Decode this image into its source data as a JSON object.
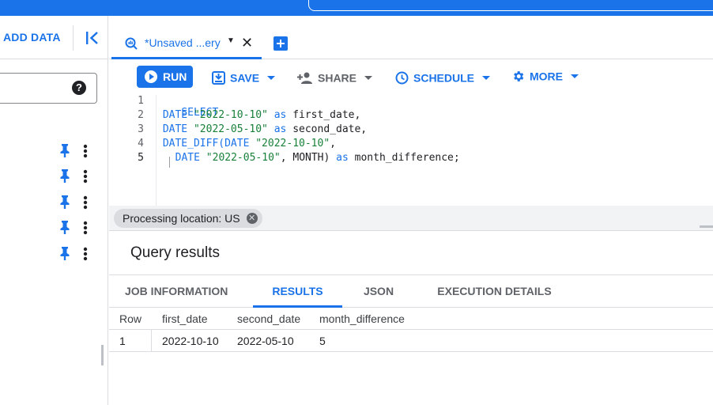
{
  "topbar": {
    "search_text": "",
    "crop_text": ""
  },
  "sidebar": {
    "add_data_label": "ADD DATA",
    "help_glyph": "?",
    "pin_rows": 5
  },
  "tab": {
    "label": "*Unsaved ...ery",
    "close_glyph": "✕"
  },
  "toolbar": {
    "run_label": "RUN",
    "save_label": "SAVE",
    "share_label": "SHARE",
    "schedule_label": "SCHEDULE",
    "more_label": "MORE"
  },
  "editor": {
    "line_numbers": [
      "1",
      "2",
      "3",
      "4",
      "5"
    ],
    "lines": [
      [
        "SELECT"
      ],
      [
        " DATE ",
        "\"2022-10-10\"",
        " as ",
        "first_date,"
      ],
      [
        " DATE ",
        "\"2022-05-10\"",
        " as ",
        "second_date,"
      ],
      [
        " DATE_DIFF(DATE ",
        "\"2022-10-10\"",
        ","
      ],
      [
        "  DATE ",
        "\"2022-05-10\"",
        ", MONTH) ",
        "as",
        " month_difference;"
      ]
    ]
  },
  "processing": {
    "label": "Processing location: US"
  },
  "results": {
    "title": "Query results",
    "tabs": [
      "JOB INFORMATION",
      "RESULTS",
      "JSON",
      "EXECUTION DETAILS"
    ],
    "active_tab": "RESULTS",
    "columns": [
      "Row",
      "first_date",
      "second_date",
      "month_difference"
    ],
    "rows": [
      [
        "1",
        "2022-10-10",
        "2022-05-10",
        "5"
      ]
    ]
  },
  "colors": {
    "accent": "#1a73e8",
    "string": "#188038",
    "topbar": "#1a73e8"
  }
}
